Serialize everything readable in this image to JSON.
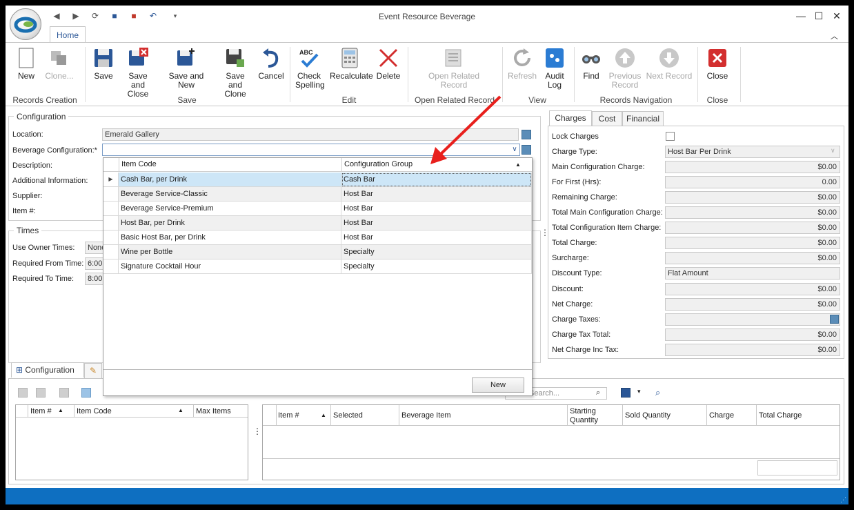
{
  "window": {
    "title": "Event Resource Beverage"
  },
  "ribbon": {
    "tab_home": "Home",
    "buttons": {
      "new": "New",
      "clone": "Clone...",
      "save": "Save",
      "save_close_1": "Save and",
      "save_close_2": "Close",
      "save_new": "Save and New",
      "save_clone_1": "Save and",
      "save_clone_2": "Clone",
      "cancel": "Cancel",
      "check_spelling_1": "Check",
      "check_spelling_2": "Spelling",
      "recalculate": "Recalculate",
      "delete": "Delete",
      "open_related_1": "Open Related",
      "open_related_2": "Record",
      "refresh": "Refresh",
      "audit_1": "Audit",
      "audit_2": "Log",
      "find": "Find",
      "prev_1": "Previous",
      "prev_2": "Record",
      "next_record": "Next Record",
      "close": "Close"
    },
    "groups": {
      "records_creation": "Records Creation",
      "save": "Save",
      "edit": "Edit",
      "open_related": "Open Related Record",
      "view": "View",
      "records_navigation": "Records Navigation",
      "close": "Close"
    }
  },
  "configuration": {
    "title": "Configuration",
    "location_label": "Location:",
    "location_value": "Emerald Gallery",
    "beverage_config_label": "Beverage Configuration:*",
    "description_label": "Description:",
    "additional_info_label": "Additional Information:",
    "supplier_label": "Supplier:",
    "item_no_label": "Item #:"
  },
  "times": {
    "title": "Times",
    "use_owner_label": "Use Owner Times:",
    "use_owner_value": "None",
    "from_label": "Required From Time:",
    "from_value": "6:00",
    "to_label": "Required To Time:",
    "to_value": "8:00"
  },
  "dropdown": {
    "col_item_code": "Item Code",
    "col_config_group": "Configuration Group",
    "rows": [
      {
        "code": "Cash Bar, per Drink",
        "group": "Cash Bar"
      },
      {
        "code": "Beverage Service-Classic",
        "group": "Host Bar"
      },
      {
        "code": "Beverage Service-Premium",
        "group": "Host Bar"
      },
      {
        "code": "Host Bar, per Drink",
        "group": "Host Bar"
      },
      {
        "code": "Basic Host Bar, per Drink",
        "group": "Host Bar"
      },
      {
        "code": "Wine per Bottle",
        "group": "Specialty"
      },
      {
        "code": "Signature Cocktail Hour",
        "group": "Specialty"
      }
    ],
    "new_button": "New"
  },
  "charges": {
    "tabs": [
      "Charges",
      "Cost",
      "Financial"
    ],
    "fields": [
      {
        "label": "Lock Charges"
      },
      {
        "label": "Charge Type:",
        "value": "Host Bar Per Drink"
      },
      {
        "label": "Main Configuration Charge:",
        "value": "$0.00"
      },
      {
        "label": "For First (Hrs):",
        "value": "0.00"
      },
      {
        "label": "Remaining Charge:",
        "value": "$0.00"
      },
      {
        "label": "Total Main Configuration Charge:",
        "value": "$0.00"
      },
      {
        "label": "Total Configuration Item Charge:",
        "value": "$0.00"
      },
      {
        "label": "Total Charge:",
        "value": "$0.00"
      },
      {
        "label": "Surcharge:",
        "value": "$0.00"
      },
      {
        "label": "Discount Type:",
        "value": "Flat Amount"
      },
      {
        "label": "Discount:",
        "value": "$0.00"
      },
      {
        "label": "Net Charge:",
        "value": "$0.00"
      },
      {
        "label": "Charge Taxes:",
        "value": ""
      },
      {
        "label": "Charge Tax Total:",
        "value": "$0.00"
      },
      {
        "label": "Net Charge Inc Tax:",
        "value": "$0.00"
      }
    ]
  },
  "bottom": {
    "tab_configuration": "Configuration",
    "search_placeholder": "Search...",
    "left_grid_cols": [
      "Item #",
      "Item Code",
      "Max Items"
    ],
    "right_grid_cols": [
      "Item #",
      "Selected",
      "Beverage Item",
      "Starting",
      "Quantity",
      "Sold Quantity",
      "Charge",
      "Total Charge"
    ]
  }
}
